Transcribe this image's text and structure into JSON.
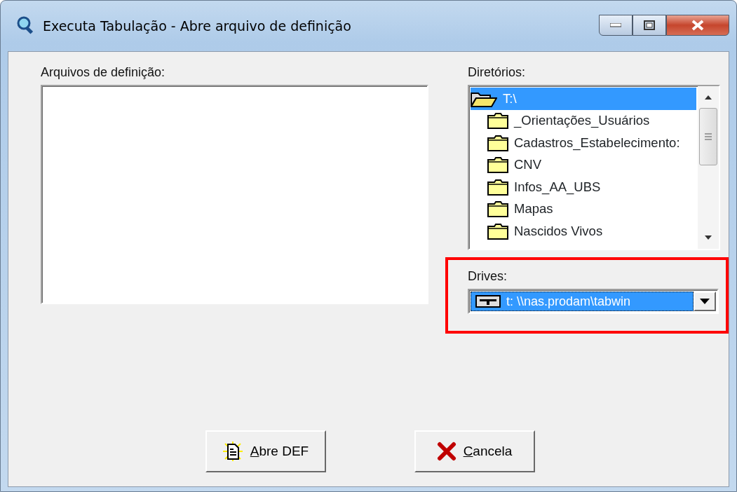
{
  "window": {
    "title": "Executa Tabulação - Abre arquivo de definição"
  },
  "definition_files": {
    "label": "Arquivos de definição:"
  },
  "directories": {
    "label": "Diretórios:",
    "items": [
      {
        "name": "T:\\",
        "kind": "root",
        "selected": true
      },
      {
        "name": "_Orientações_Usuários",
        "kind": "folder",
        "selected": false
      },
      {
        "name": "Cadastros_Estabelecimento:",
        "kind": "folder",
        "selected": false
      },
      {
        "name": "CNV",
        "kind": "folder",
        "selected": false
      },
      {
        "name": "Infos_AA_UBS",
        "kind": "folder",
        "selected": false
      },
      {
        "name": "Mapas",
        "kind": "folder",
        "selected": false
      },
      {
        "name": "Nascidos Vivos",
        "kind": "folder",
        "selected": false
      }
    ]
  },
  "drives": {
    "label": "Drives:",
    "value": "t: \\\\nas.prodam\\tabwin",
    "highlighted": true
  },
  "buttons": [
    {
      "label": "Abre DEF",
      "kind": "open",
      "underline_first": true
    },
    {
      "label": "Cancela",
      "kind": "cancel",
      "underline_first": true
    }
  ]
}
